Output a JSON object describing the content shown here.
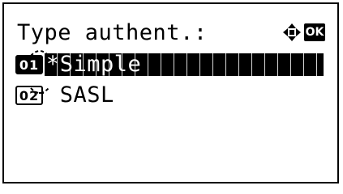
{
  "screen": {
    "title": "Type authent.:",
    "nav_icon": "four-way-arrow-icon",
    "ok_label": "OK"
  },
  "options": [
    {
      "number": "01",
      "label": "*Simple",
      "selected": true
    },
    {
      "number": "02",
      "label": " SASL",
      "selected": false
    }
  ]
}
